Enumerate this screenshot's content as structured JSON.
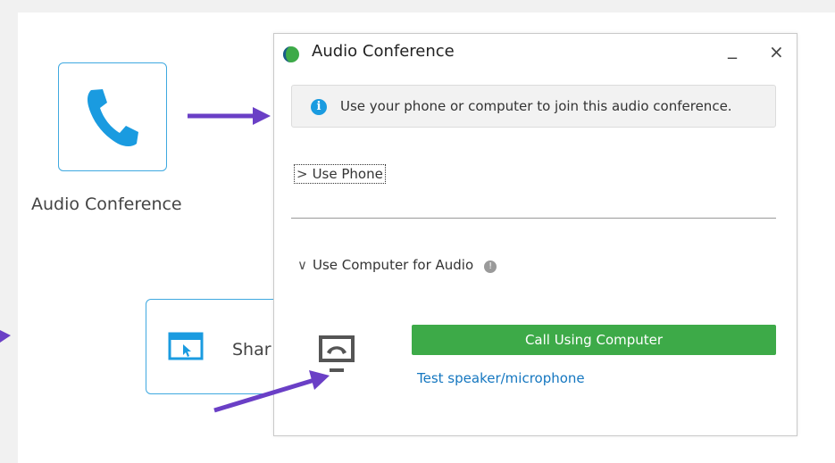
{
  "background_tiles": {
    "audio_tile_label": "Audio Conference",
    "share_tile_label": "Shar"
  },
  "dialog": {
    "title": "Audio Conference",
    "minimize_glyph": "_",
    "close_glyph": "×",
    "info_message": "Use your phone or computer to join this audio conference.",
    "use_phone_label": "Use Phone",
    "use_computer_label": "Use Computer for Audio",
    "call_button_label": "Call Using Computer",
    "test_link_label": "Test speaker/microphone"
  },
  "icons": {
    "logo": "app-logo-icon",
    "phone": "phone-icon",
    "share": "share-screen-icon",
    "info": "info-icon",
    "help": "help-icon",
    "computer_audio": "computer-audio-icon",
    "annotation_arrow": "annotation-arrow"
  },
  "colors": {
    "accent_blue": "#1a9be0",
    "tile_border": "#3fa9e0",
    "call_button": "#3daa48",
    "link": "#1577c0",
    "annotation_arrow": "#6a3fc6"
  }
}
